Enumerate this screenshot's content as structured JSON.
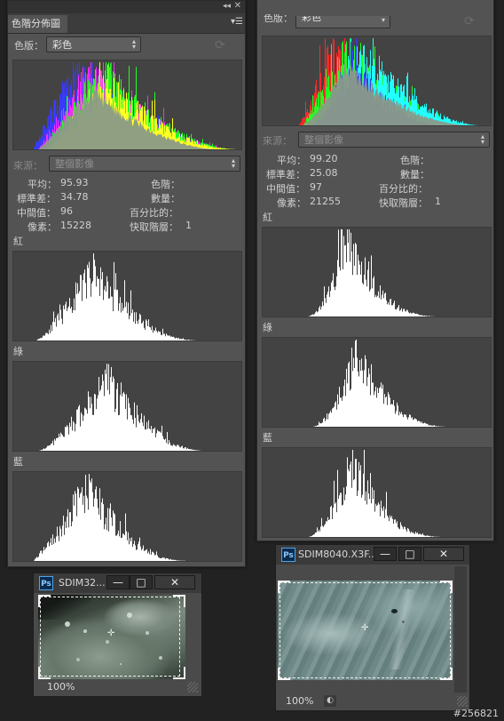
{
  "left_panel": {
    "tab_title": "色階分佈圖",
    "collapse_icon": "double-chevron-left",
    "close_icon": "x",
    "menu_icon": "panel-menu",
    "channel_label": "色版：",
    "channel_value": "彩色",
    "source_label": "來源：",
    "source_value": "整個影像",
    "stats": {
      "mean_label": "平均：",
      "mean": "95.93",
      "std_label": "標準差：",
      "std": "34.78",
      "median_label": "中間值：",
      "median": "96",
      "pixels_label": "像素：",
      "pixels": "15228",
      "level_label": "色階：",
      "level": "",
      "count_label": "數量：",
      "count": "",
      "percentile_label": "百分比的：",
      "percentile": "",
      "cache_label": "快取階層：",
      "cache": "1"
    },
    "red_label": "紅",
    "green_label": "綠",
    "blue_label": "藍"
  },
  "right_panel": {
    "channel_label": "色版：",
    "channel_value": "彩色",
    "source_label": "來源：",
    "source_value": "整個影像",
    "stats": {
      "mean_label": "平均：",
      "mean": "99.20",
      "std_label": "標準差：",
      "std": "25.08",
      "median_label": "中間值：",
      "median": "97",
      "pixels_label": "像素：",
      "pixels": "21255",
      "level_label": "色階：",
      "level": "",
      "count_label": "數量：",
      "count": "",
      "percentile_label": "百分比的：",
      "percentile": "",
      "cache_label": "快取階層：",
      "cache": "1"
    },
    "red_label": "紅",
    "green_label": "綠",
    "blue_label": "藍"
  },
  "doc_window_left": {
    "app_icon": "Ps",
    "title": "SDIM32...",
    "zoom": "100%"
  },
  "doc_window_right": {
    "app_icon": "Ps",
    "title": "SDIM8040.X3F...",
    "zoom": "100%"
  },
  "window_buttons": {
    "minimize": "—",
    "restore": "□",
    "close": "✕"
  },
  "image_id": "#256821",
  "colors": {
    "panel_bg": "#535353",
    "hist_bg": "#434343",
    "hist_fill": "#ffffff",
    "composite_gray": "#8a9a88",
    "red": "#ff2a2a",
    "green": "#22ff22",
    "blue": "#3a3aff",
    "cyan": "#22ffff",
    "magenta": "#ff2aff",
    "yellow": "#ffff22"
  }
}
